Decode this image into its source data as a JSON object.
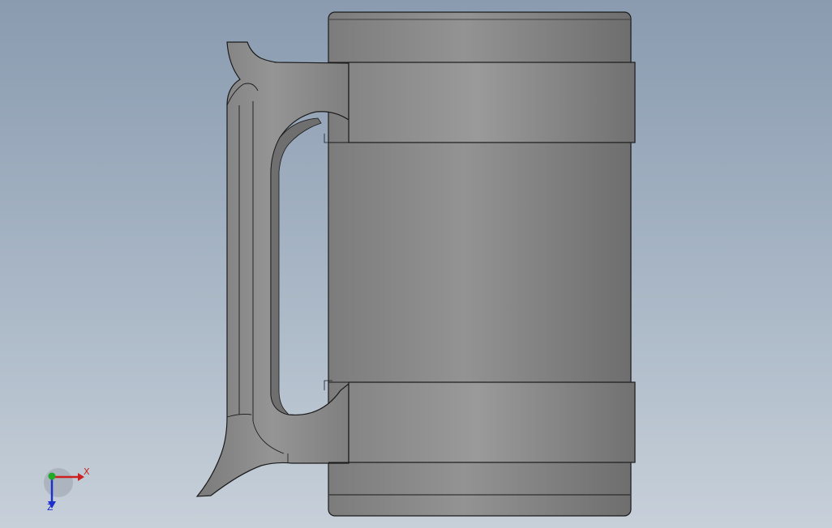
{
  "viewport": {
    "background_top": "#8a9bb0",
    "background_bottom": "#c7d0d9"
  },
  "model": {
    "part": "mug-body-with-handle",
    "body_color": "#8c8c8c",
    "edge_color": "#1a1a1a"
  },
  "triad": {
    "x_label": "X",
    "z_label": "Z",
    "x_color": "#cc1f1f",
    "y_color": "#1faa2a",
    "z_color": "#1f2fcc"
  }
}
